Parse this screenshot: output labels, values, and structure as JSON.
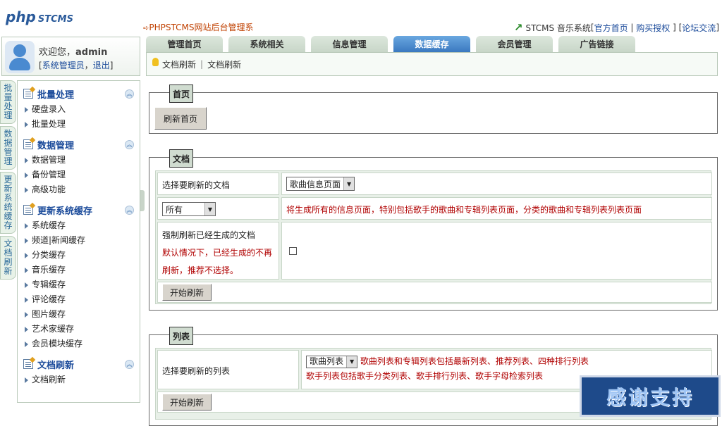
{
  "header": {
    "logo_php": "php",
    "logo_stcms": "STCMS",
    "site_title": "PHPSTCMS网站后台管理系",
    "system_name": "STCMS 音乐系统",
    "links": [
      "官方首页",
      "购买授权",
      "论坛交流"
    ]
  },
  "user": {
    "welcome": "欢迎您，",
    "name": "admin",
    "role_link": "系统管理员",
    "logout_link": "退出"
  },
  "vertical_tabs": [
    "批量处理",
    "数据管理",
    "更新系统缓存",
    "文档刷新"
  ],
  "sidebar": {
    "groups": [
      {
        "title": "批量处理",
        "items": [
          "硬盘录入",
          "批量处理"
        ]
      },
      {
        "title": "数据管理",
        "items": [
          "数据管理",
          "备份管理",
          "高级功能"
        ]
      },
      {
        "title": "更新系统缓存",
        "items": [
          "系统缓存",
          "频道|新闻缓存",
          "分类缓存",
          "音乐缓存",
          "专辑缓存",
          "评论缓存",
          "图片缓存",
          "艺术家缓存",
          "会员模块缓存"
        ]
      },
      {
        "title": "文档刷新",
        "items": [
          "文档刷新"
        ]
      }
    ]
  },
  "tabs": [
    "管理首页",
    "系统相关",
    "信息管理",
    "数据缓存",
    "会员管理",
    "广告链接"
  ],
  "active_tab": "数据缓存",
  "breadcrumb": [
    "文档刷新",
    "文档刷新"
  ],
  "panel_home": {
    "legend": "首页",
    "button": "刷新首页"
  },
  "panel_docs": {
    "legend": "文档",
    "select_label": "选择要刷新的文档",
    "doc_select_value": "歌曲信息页面",
    "scope_select_value": "所有",
    "scope_note": "将生成所有的信息页面，特别包括歌手的歌曲和专辑列表页面，分类的歌曲和专辑列表列表页面",
    "force_label": "强制刷新已经生成的文档",
    "force_note": "默认情况下，已经生成的不再刷新，推荐不选择。",
    "button": "开始刷新"
  },
  "panel_list": {
    "legend": "列表",
    "select_label": "选择要刷新的列表",
    "list_select_value": "歌曲列表",
    "note1": "歌曲列表和专辑列表包括最新列表、推荐列表、四种排行列表",
    "note2": "歌手列表包括歌手分类列表、歌手排行列表、歌手字母检索列表",
    "button": "开始刷新"
  },
  "banner": "感谢支持",
  "colors": {
    "active_tab": "#3a78c0",
    "link": "#1a4a9a",
    "note_red": "#b00000",
    "panel_bg": "#e8f0e8"
  }
}
